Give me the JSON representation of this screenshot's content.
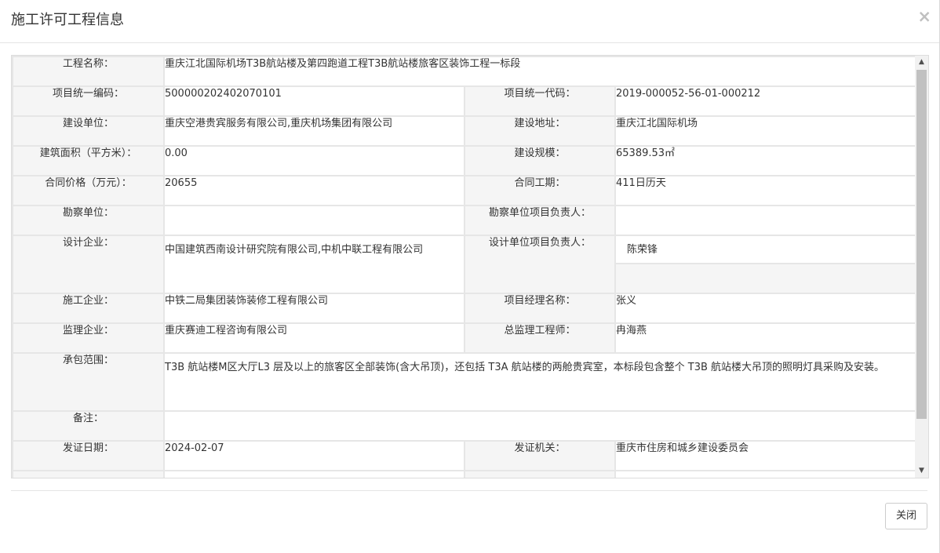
{
  "header": {
    "title": "施工许可工程信息",
    "close_symbol": "×"
  },
  "rows": {
    "project_name": {
      "label": "工程名称：",
      "value": "重庆江北国际机场T3B航站楼及第四跑道工程T3B航站楼旅客区装饰工程一标段"
    },
    "unified_number": {
      "label": "项目统一编码：",
      "value": "500000202402070101"
    },
    "unified_code": {
      "label": "项目统一代码：",
      "value": "2019-000052-56-01-000212"
    },
    "builder": {
      "label": "建设单位：",
      "value": "重庆空港贵宾服务有限公司,重庆机场集团有限公司"
    },
    "address": {
      "label": "建设地址：",
      "value": "重庆江北国际机场"
    },
    "area": {
      "label": "建筑面积（平方米）：",
      "value": "0.00"
    },
    "scale": {
      "label": "建设规模：",
      "value": "65389.53㎡"
    },
    "price": {
      "label": "合同价格（万元）：",
      "value": "20655"
    },
    "period": {
      "label": "合同工期：",
      "value": "411日历天"
    },
    "survey": {
      "label": "勘察单位：",
      "value": ""
    },
    "survey_leader": {
      "label": "勘察单位项目负责人：",
      "value": ""
    },
    "design": {
      "label": "设计企业：",
      "value": "中国建筑西南设计研究院有限公司,中机中联工程有限公司"
    },
    "design_leader": {
      "label": "设计单位项目负责人：",
      "value": "陈荣锋"
    },
    "construction": {
      "label": "施工企业：",
      "value": "中铁二局集团装饰装修工程有限公司"
    },
    "manager": {
      "label": "项目经理名称：",
      "value": "张义"
    },
    "supervision": {
      "label": "监理企业：",
      "value": "重庆赛迪工程咨询有限公司"
    },
    "chief_supervisor": {
      "label": "总监理工程师：",
      "value": "冉海燕"
    },
    "scope": {
      "label": "承包范围：",
      "value": "T3B 航站楼M区大厅L3 层及以上的旅客区全部装饰(含大吊顶)，还包括 T3A 航站楼的两舱贵宾室，本标段包含整个 T3B 航站楼大吊顶的照明灯具采购及安装。"
    },
    "remark": {
      "label": "备注：",
      "value": ""
    },
    "issue_date": {
      "label": "发证日期：",
      "value": "2024-02-07"
    },
    "issuer": {
      "label": "发证机关：",
      "value": "重庆市住房和城乡建设委员会"
    }
  },
  "footer": {
    "close_button": "关闭"
  }
}
